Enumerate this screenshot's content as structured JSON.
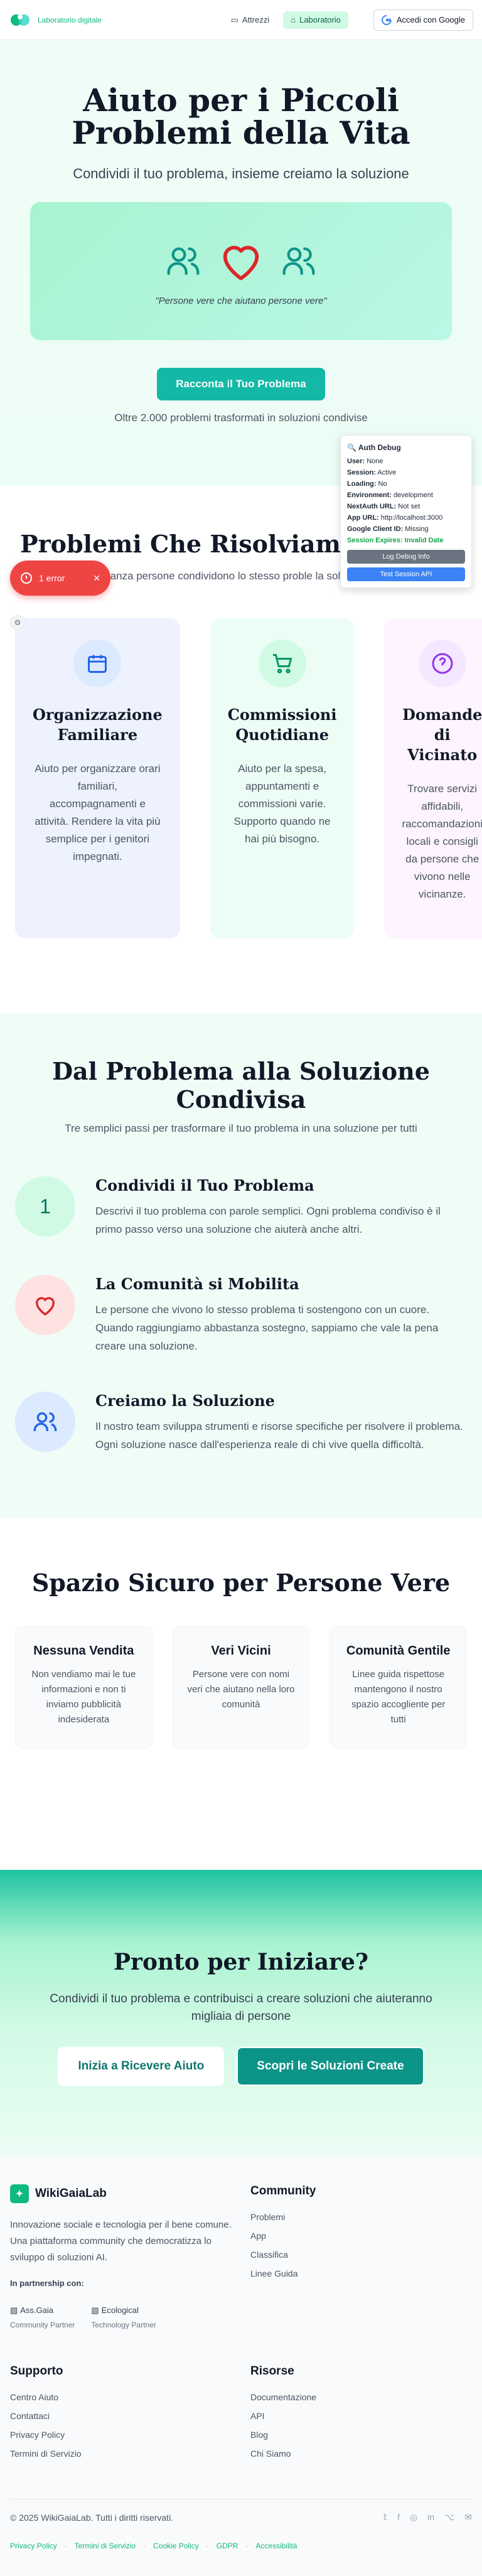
{
  "header": {
    "logo_text": "Laboratorio digitale",
    "nav": [
      {
        "label": "Attrezzi",
        "icon": "folder-icon"
      },
      {
        "label": "Laboratorio",
        "icon": "home-icon"
      }
    ],
    "login_label": "Accedi con Google"
  },
  "hero": {
    "title": "Aiuto per i Piccoli Problemi della Vita",
    "subtitle": "Condividi il tuo problema, insieme creiamo la soluzione",
    "quote": "\"Persone vere che aiutano persone vere\"",
    "cta": "Racconta il Tuo Problema",
    "stat": "Oltre 2.000 problemi trasformati in soluzioni condivise"
  },
  "debug": {
    "title": "🔍 Auth Debug",
    "rows": [
      {
        "k": "User:",
        "v": "None"
      },
      {
        "k": "Session:",
        "v": "Active"
      },
      {
        "k": "Loading:",
        "v": "No"
      },
      {
        "k": "Environment:",
        "v": "development"
      },
      {
        "k": "NextAuth URL:",
        "v": "Not set"
      },
      {
        "k": "App URL:",
        "v": "http://localhost:3000"
      },
      {
        "k": "Google Client ID:",
        "v": "Missing"
      }
    ],
    "expires_label": "Session Expires:",
    "expires_value": "Invalid Date",
    "btn_log": "Log Debug Info",
    "btn_test": "Test Session API"
  },
  "error_pill": {
    "label": "1 error"
  },
  "problems": {
    "title": "Problemi Che Risolviamo Os",
    "subtitle": "anza persone condividono lo stesso proble la soluzione",
    "cards": [
      {
        "title": "Organizzazione Familiare",
        "text": "Aiuto per organizzare orari familiari, accompagnamenti e attività. Rendere la vita più semplice per i genitori impegnati.",
        "icon": "calendar-icon",
        "bg": "#eef2ff",
        "circle": "#dbeafe",
        "color": "#2563eb"
      },
      {
        "title": "Commissioni Quotidiane",
        "text": "Aiuto per la spesa, appuntamenti e commissioni varie. Supporto quando ne hai più bisogno.",
        "icon": "cart-icon",
        "bg": "#ecfdf5",
        "circle": "#d1fae5",
        "color": "#059669"
      },
      {
        "title": "Domande di Vicinato",
        "text": "Trovare servizi affidabili, raccomandazioni locali e consigli da persone che vivono nelle vicinanze.",
        "icon": "question-icon",
        "bg": "#fdf4ff",
        "circle": "#f3e8ff",
        "color": "#9333ea"
      }
    ]
  },
  "steps": {
    "title": "Dal Problema alla Soluzione Condivisa",
    "subtitle": "Tre semplici passi per trasformare il tuo problema in una soluzione per tutti",
    "items": [
      {
        "marker": "1",
        "title": "Condividi il Tuo Problema",
        "text": "Descrivi il tuo problema con parole semplici. Ogni problema condiviso è il primo passo verso una soluzione che aiuterà anche altri."
      },
      {
        "marker": "",
        "title": "La Comunità si Mobilita",
        "text": "Le persone che vivono lo stesso problema ti sostengono con un cuore. Quando raggiungiamo abbastanza sostegno, sappiamo che vale la pena creare una soluzione."
      },
      {
        "marker": "",
        "title": "Creiamo la Soluzione",
        "text": "Il nostro team sviluppa strumenti e risorse specifiche per risolvere il problema. Ogni soluzione nasce dall'esperienza reale di chi vive quella difficoltà."
      }
    ]
  },
  "safe": {
    "title": "Spazio Sicuro per Persone Vere",
    "cards": [
      {
        "title": "Nessuna Vendita",
        "text": "Non vendiamo mai le tue informazioni e non ti inviamo pubblicità indesiderata"
      },
      {
        "title": "Veri Vicini",
        "text": "Persone vere con nomi veri che aiutano nella loro comunità"
      },
      {
        "title": "Comunità Gentile",
        "text": "Linee guida rispettose mantengono il nostro spazio accogliente per tutti"
      }
    ]
  },
  "ready": {
    "title": "Pronto per Iniziare?",
    "subtitle": "Condividi il tuo problema e contribuisci a creare soluzioni che aiuteranno migliaia di persone",
    "btn_primary": "Inizia a Ricevere Aiuto",
    "btn_secondary": "Scopri le Soluzioni Create"
  },
  "footer": {
    "brand": "WikiGaiaLab",
    "description": "Innovazione sociale e tecnologia per il bene comune. Una piattaforma community che democratizza lo sviluppo di soluzioni AI.",
    "partnership_title": "In partnership con:",
    "partners": [
      {
        "img_alt": "Ass.Gaia",
        "caption": "Community Partner"
      },
      {
        "img_alt": "Ecological",
        "caption": "Technology Partner"
      }
    ],
    "community_title": "Community",
    "community_links": [
      "Problemi",
      "App",
      "Classifica",
      "Linee Guida"
    ],
    "support_title": "Supporto",
    "support_links": [
      "Centro Aiuto",
      "Contattaci",
      "Privacy Policy",
      "Termini di Servizio"
    ],
    "resources_title": "Risorse",
    "resources_links": [
      "Documentazione",
      "API",
      "Blog",
      "Chi Siamo"
    ],
    "copyright": "© 2025 WikiGaiaLab. Tutti i diritti riservati.",
    "legal": [
      "Privacy Policy",
      "Termini di Servizio",
      "Cookie Policy",
      "GDPR",
      "Accessibilità"
    ]
  }
}
